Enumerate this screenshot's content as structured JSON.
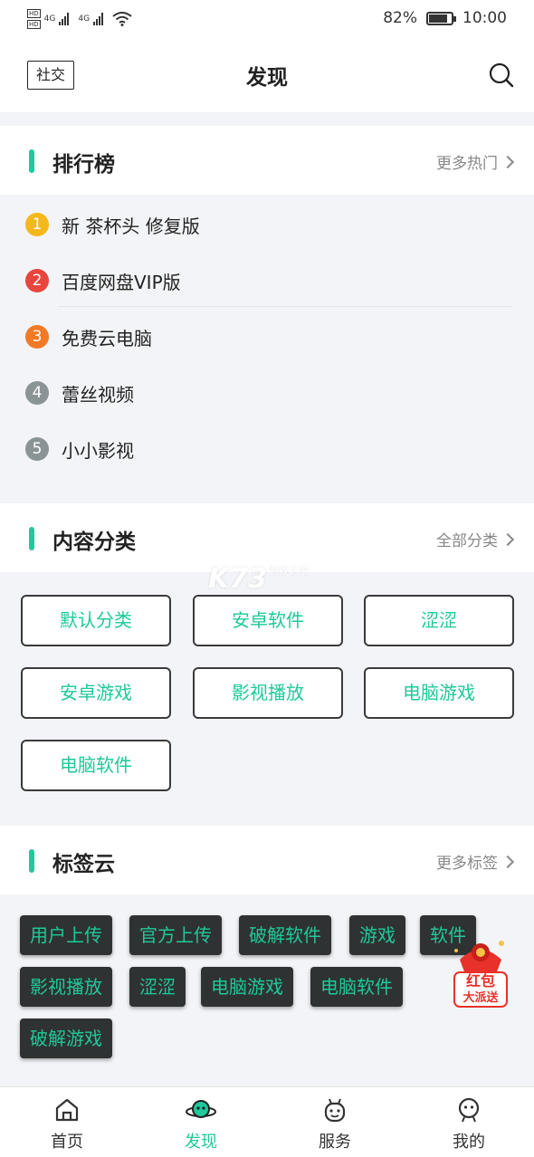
{
  "status_bar": {
    "network1": "4G",
    "network2": "4G",
    "battery": "82%",
    "battery_level": 0.82,
    "time": "10:00"
  },
  "header": {
    "social_label": "社交",
    "title": "发现"
  },
  "ranking": {
    "title": "排行榜",
    "more": "更多热门",
    "items": [
      {
        "rank": "1",
        "name": "新 茶杯头 修复版",
        "color": "#f5b81c"
      },
      {
        "rank": "2",
        "name": "百度网盘VIP版",
        "color": "#e8453c"
      },
      {
        "rank": "3",
        "name": "免费云电脑",
        "color": "#f27a26"
      },
      {
        "rank": "4",
        "name": "蕾丝视频",
        "color": "#8a9497"
      },
      {
        "rank": "5",
        "name": "小小影视",
        "color": "#8a9497"
      }
    ]
  },
  "categories": {
    "title": "内容分类",
    "more": "全部分类",
    "items": [
      "默认分类",
      "安卓软件",
      "涩涩",
      "安卓游戏",
      "影视播放",
      "电脑游戏",
      "电脑软件"
    ]
  },
  "tags": {
    "title": "标签云",
    "more": "更多标签",
    "items": [
      "用户上传",
      "官方上传",
      "破解软件",
      "游戏",
      "软件",
      "影视播放",
      "涩涩",
      "电脑游戏",
      "电脑软件",
      "破解游戏"
    ]
  },
  "watermark": {
    "logo": "K73",
    "sub": "游戏之家"
  },
  "promo": {
    "line1": "红包",
    "line2": "大派送"
  },
  "tabbar": [
    {
      "label": "首页",
      "icon": "home-icon"
    },
    {
      "label": "发现",
      "icon": "discover-planet-icon"
    },
    {
      "label": "服务",
      "icon": "service-robot-icon"
    },
    {
      "label": "我的",
      "icon": "profile-icon"
    }
  ],
  "colors": {
    "accent": "#1ec99a",
    "tag_bg": "#2f3232",
    "page_bg": "#f3f4f7"
  }
}
